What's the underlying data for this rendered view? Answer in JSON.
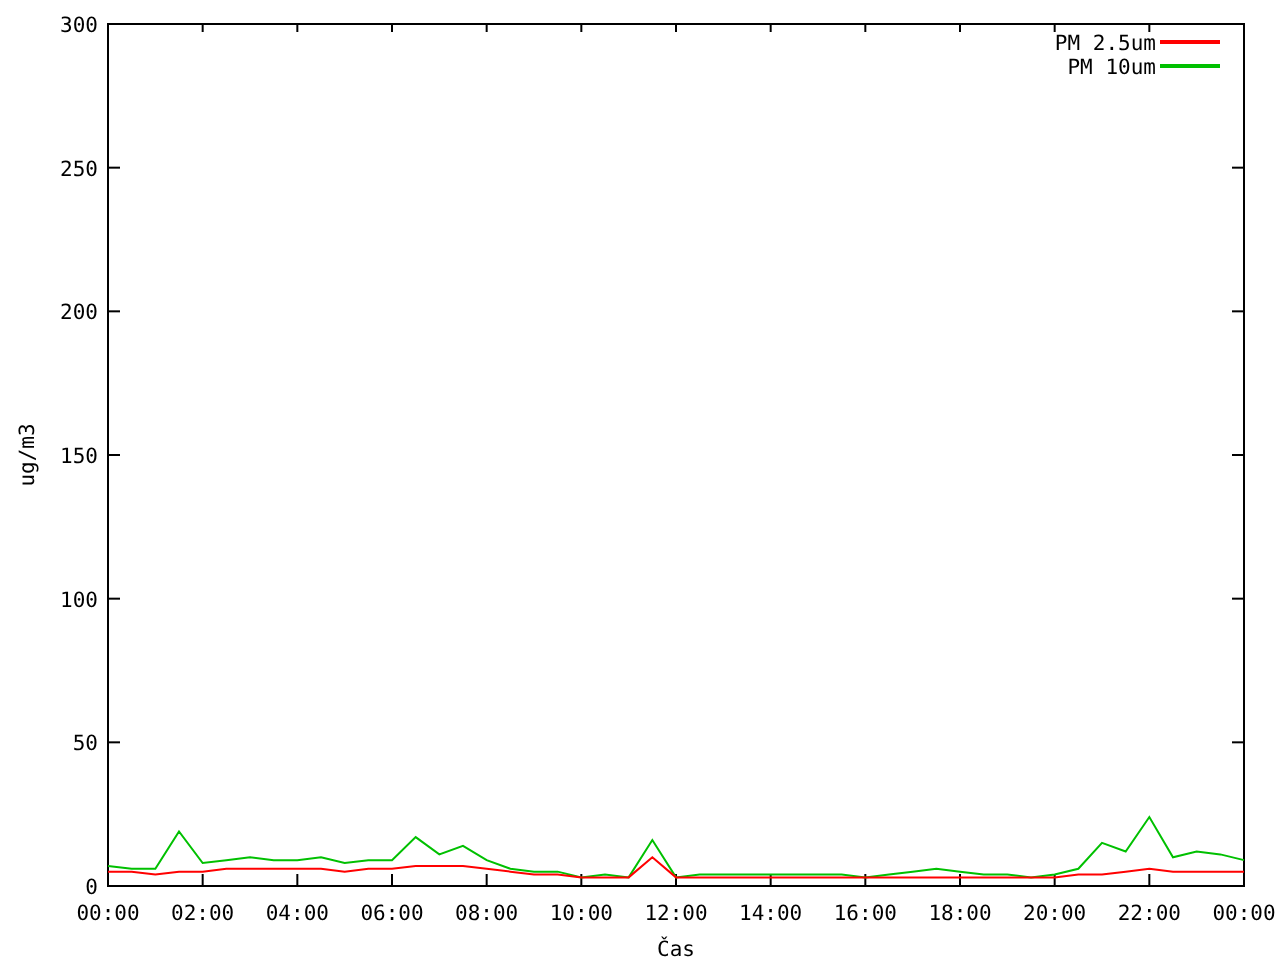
{
  "chart_data": {
    "type": "line",
    "xlabel": "Čas",
    "ylabel": "ug/m3",
    "x": [
      0,
      0.5,
      1,
      1.5,
      2,
      2.5,
      3,
      3.5,
      4,
      4.5,
      5,
      5.5,
      6,
      6.5,
      7,
      7.5,
      8,
      8.5,
      9,
      9.5,
      10,
      10.5,
      11,
      11.5,
      12,
      12.5,
      13,
      13.5,
      14,
      14.5,
      15,
      15.5,
      16,
      16.5,
      17,
      17.5,
      18,
      18.5,
      19,
      19.5,
      20,
      20.5,
      21,
      21.5,
      22,
      22.5,
      23,
      23.5,
      24
    ],
    "series": [
      {
        "name": "PM 2.5um",
        "color": "#ff0000",
        "values": [
          5,
          5,
          4,
          5,
          5,
          6,
          6,
          6,
          6,
          6,
          5,
          6,
          6,
          7,
          7,
          7,
          6,
          5,
          4,
          4,
          3,
          3,
          3,
          10,
          3,
          3,
          3,
          3,
          3,
          3,
          3,
          3,
          3,
          3,
          3,
          3,
          3,
          3,
          3,
          3,
          3,
          4,
          4,
          5,
          6,
          5,
          5,
          5,
          5
        ]
      },
      {
        "name": "PM 10um",
        "color": "#00c000",
        "values": [
          7,
          6,
          6,
          19,
          8,
          9,
          10,
          9,
          9,
          10,
          8,
          9,
          9,
          17,
          11,
          14,
          9,
          6,
          5,
          5,
          3,
          4,
          3,
          16,
          3,
          4,
          4,
          4,
          4,
          4,
          4,
          4,
          3,
          4,
          5,
          6,
          5,
          4,
          4,
          3,
          4,
          6,
          15,
          12,
          24,
          10,
          12,
          11,
          9
        ]
      }
    ],
    "xlim": [
      0,
      24
    ],
    "ylim": [
      0,
      300
    ],
    "legend": "top-right",
    "xticks": [
      {
        "value": 0,
        "label": "00:00"
      },
      {
        "value": 2,
        "label": "02:00"
      },
      {
        "value": 4,
        "label": "04:00"
      },
      {
        "value": 6,
        "label": "06:00"
      },
      {
        "value": 8,
        "label": "08:00"
      },
      {
        "value": 10,
        "label": "10:00"
      },
      {
        "value": 12,
        "label": "12:00"
      },
      {
        "value": 14,
        "label": "14:00"
      },
      {
        "value": 16,
        "label": "16:00"
      },
      {
        "value": 18,
        "label": "18:00"
      },
      {
        "value": 20,
        "label": "20:00"
      },
      {
        "value": 22,
        "label": "22:00"
      },
      {
        "value": 24,
        "label": "00:00"
      }
    ],
    "yticks": [
      0,
      50,
      100,
      150,
      200,
      250,
      300
    ]
  }
}
